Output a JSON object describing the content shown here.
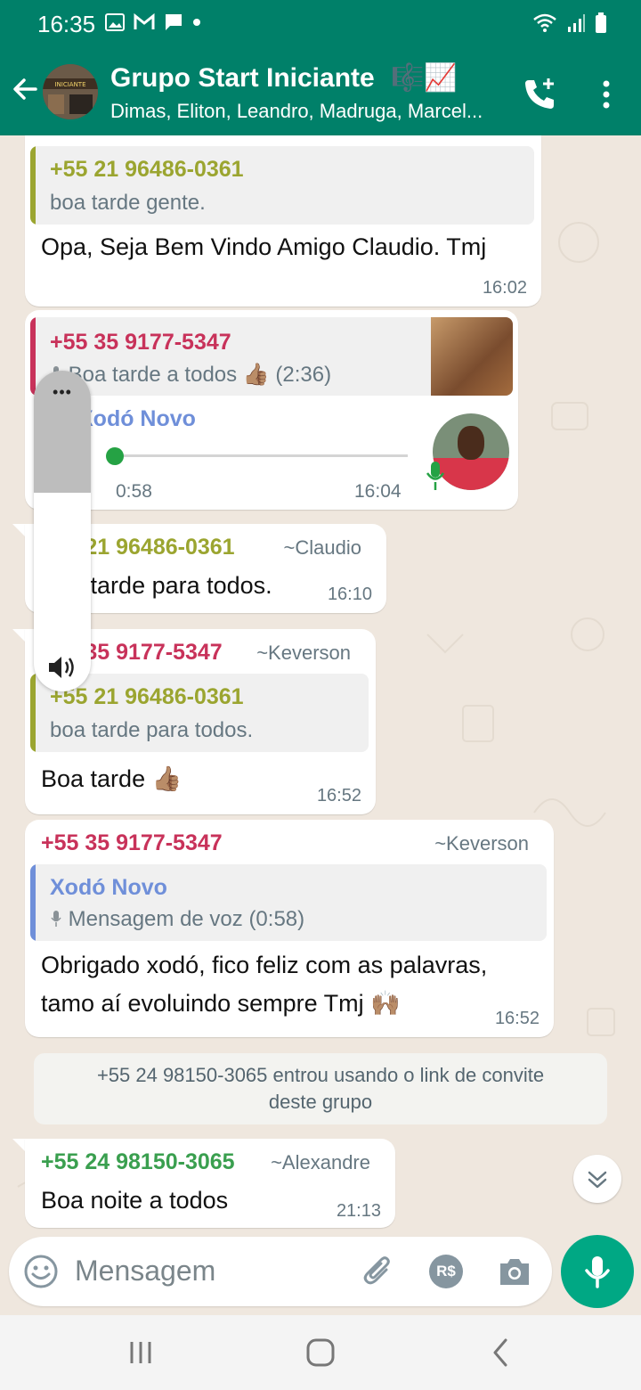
{
  "status_bar": {
    "time": "16:35"
  },
  "header": {
    "title": "Grupo Start Iniciante",
    "title_emoji": "🎼📈",
    "avatar_text": "INICIANTE",
    "members": "Dimas, Eliton, Leandro, Madruga, Marcel..."
  },
  "messages": [
    {
      "quote_name": "+55 21 96486-0361",
      "quote_text": "boa tarde gente.",
      "text": "Opa, Seja Bem Vindo Amigo Claudio. Tmj",
      "time": "16:02"
    },
    {
      "quote_name": "+55 35 9177-5347",
      "quote_text": "Boa tarde a todos 👍🏽 (2:36)",
      "voice_sender": "Xodó Novo",
      "voice_duration": "0:58",
      "voice_progress": 0,
      "time": "16:04"
    },
    {
      "sender": "+55 21 96486-0361",
      "pushname": "~Claudio",
      "text": "Boa tarde  para todos.",
      "time": "16:10"
    },
    {
      "sender": "+55 35 9177-5347",
      "pushname": "~Keverson",
      "quote_name": "+55 21 96486-0361",
      "quote_text": "boa tarde  para todos.",
      "text": "Boa tarde 👍🏽",
      "time": "16:52"
    },
    {
      "sender": "+55 35 9177-5347",
      "pushname": "~Keverson",
      "quote_name": "Xodó Novo",
      "quote_text": "Mensagem de voz (0:58)",
      "text_line1": "Obrigado xodó, fico feliz com as palavras,",
      "text_line2": "tamo aí evoluindo sempre Tmj 🙌🏽",
      "time": "16:52"
    },
    {
      "sender": "+55 24 98150-3065",
      "pushname": "~Alexandre",
      "text": "Boa noite a todos",
      "time": "21:13"
    }
  ],
  "system_message": {
    "line1": "+55 24 98150-3065 entrou usando o link de convite",
    "line2": "deste grupo"
  },
  "volume_panel": {
    "menu_dots": "•••",
    "level": 0.62
  },
  "composer": {
    "placeholder": "Mensagem",
    "currency_label": "R$"
  },
  "colors": {
    "header": "#008069",
    "chat_background": "#efe7de",
    "sender_green": "#3a9f4f",
    "sender_olive": "#9ba530",
    "sender_crimson": "#c8325a",
    "sender_blue": "#6f8fd9",
    "accent": "#00a884"
  }
}
